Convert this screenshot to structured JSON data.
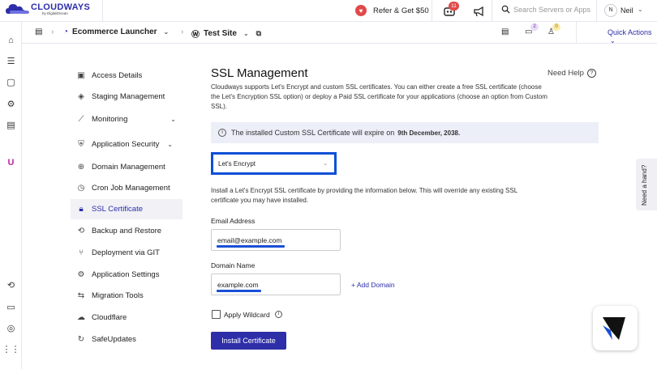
{
  "brand": {
    "name": "CLOUDWAYS",
    "sub": "by DigitalOcean"
  },
  "topbar": {
    "refer_label": "Refer & Get $50",
    "notif_count": "11",
    "search_placeholder": "Search Servers or Apps",
    "user_initial": "N",
    "user_name": "Neil"
  },
  "subbar": {
    "server_name": "Ecommerce Launcher",
    "site_name": "Test Site",
    "badge_1": "2",
    "badge_2": "0",
    "quick_actions": "Quick Actions"
  },
  "menu": {
    "items": [
      {
        "label": "Access Details",
        "icon": "id-card-icon"
      },
      {
        "label": "Staging Management",
        "icon": "layers-icon"
      },
      {
        "label": "Monitoring",
        "icon": "chart-icon",
        "expandable": true
      },
      {
        "label": "Application Security",
        "icon": "shield-user-icon",
        "expandable": true
      },
      {
        "label": "Domain Management",
        "icon": "globe-icon"
      },
      {
        "label": "Cron Job Management",
        "icon": "clock-icon"
      },
      {
        "label": "SSL Certificate",
        "icon": "lock-icon",
        "active": true
      },
      {
        "label": "Backup and Restore",
        "icon": "backup-icon"
      },
      {
        "label": "Deployment via GIT",
        "icon": "git-icon"
      },
      {
        "label": "Application Settings",
        "icon": "settings-icon"
      },
      {
        "label": "Migration Tools",
        "icon": "migration-icon"
      },
      {
        "label": "Cloudflare",
        "icon": "cloud-icon"
      },
      {
        "label": "SafeUpdates",
        "icon": "refresh-icon"
      }
    ]
  },
  "main": {
    "title": "SSL Management",
    "need_help": "Need Help",
    "description": "Cloudways supports Let's Encrypt and custom SSL certificates. You can either create a free SSL certificate (choose the Let's Encryption SSL option) or deploy a Paid SSL certificate for your applications (choose an option from Custom SSL).",
    "info_prefix": "The installed Custom SSL Certificate will expire on",
    "info_date": "9th December, 2038.",
    "ssl_type_selected": "Let's Encrypt",
    "note": "Install a Let's Encrypt SSL certificate by providing the information below. This will override any existing SSL certificate you may have installed.",
    "email_label": "Email Address",
    "email_value": "email@example.com",
    "domain_label": "Domain Name",
    "domain_value": "example.com",
    "add_domain": "+ Add Domain",
    "wildcard_label": "Apply Wildcard",
    "wildcard_checked": false,
    "install_button": "Install Certificate"
  },
  "help_tab": "Need a hand?",
  "colors": {
    "brand": "#2d2ea8",
    "highlight": "#0a4fd6",
    "info_bg": "#eceef8",
    "badge": "#e04a4a"
  }
}
